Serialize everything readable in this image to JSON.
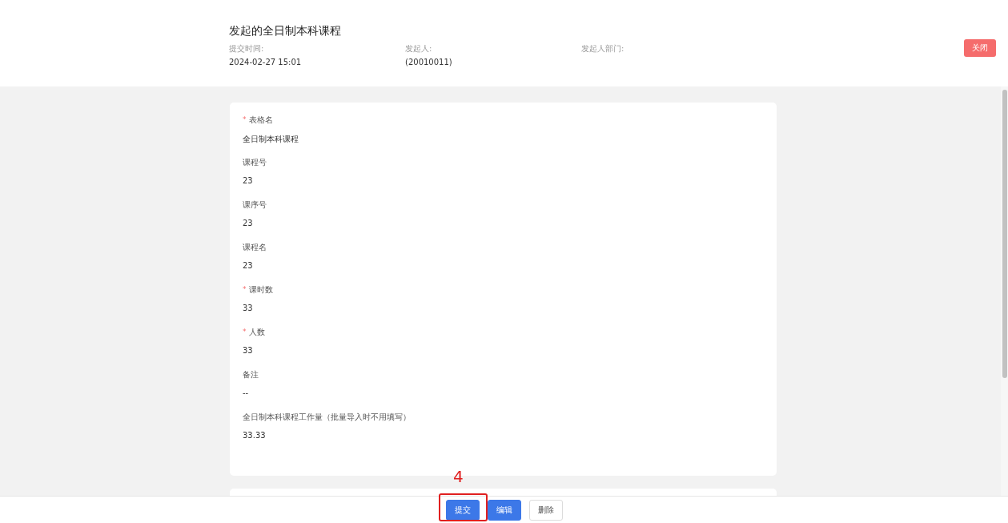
{
  "header": {
    "title": "发起的全日制本科课程",
    "meta": [
      {
        "label": "提交时间:",
        "value": "2024-02-27 15:01"
      },
      {
        "label": "发起人:",
        "value": "(20010011)"
      },
      {
        "label": "发起人部门:"
      }
    ],
    "close_button": "关闭"
  },
  "form": {
    "fields": [
      {
        "mark": "*",
        "label": "表格名",
        "value": "全日制本科课程"
      },
      {
        "label": "课程号",
        "value": "23"
      },
      {
        "label": "课序号",
        "value": "23"
      },
      {
        "label": "课程名",
        "value": "23"
      },
      {
        "mark": "*",
        "label": "课时数",
        "value": "33"
      },
      {
        "mark": "*",
        "label": "人数",
        "value": "33"
      },
      {
        "label": "备注",
        "value": "--"
      },
      {
        "label": "全日制本科课程工作量（批量导入时不用填写）",
        "value": "33.33"
      }
    ]
  },
  "footer": {
    "buttons": [
      {
        "label": "提交",
        "kind": "primary"
      },
      {
        "label": "编辑",
        "kind": "primary"
      },
      {
        "label": "删除",
        "kind": "default"
      }
    ]
  },
  "annotation": {
    "label": "4"
  }
}
